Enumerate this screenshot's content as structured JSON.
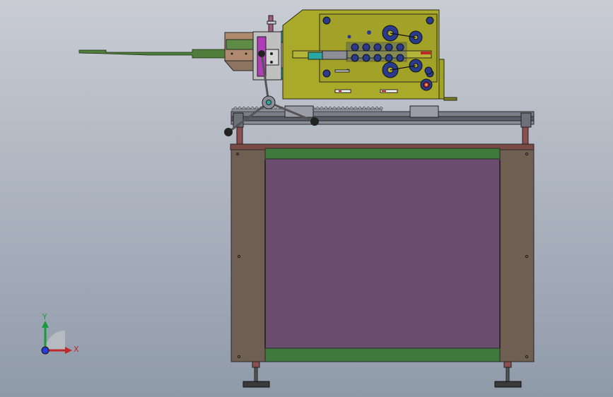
{
  "viewport": {
    "background_top": "#c9ccd3",
    "background_bottom": "#8f9aa9"
  },
  "triad": {
    "y_label": "Y",
    "x_label": "X",
    "y_color": "#1a9a3a",
    "x_color": "#c0282a",
    "z_color": "#2b3bd6"
  },
  "colors": {
    "housing": "#a9a92a",
    "feeder": "#4f7d3a",
    "rail": "#5a5d66",
    "cabinet_frame": "#6e5f52",
    "cabinet_panel": "#6a4d6e",
    "cabinet_band": "#3f7a3c",
    "top_plate": "#7a4a44",
    "post": "#8b4f4f",
    "foot": "#3a3a3a",
    "teal": "#2aa7a0",
    "magenta": "#b03cb8",
    "navy": "#2a3a8c",
    "knob": "#222222"
  }
}
